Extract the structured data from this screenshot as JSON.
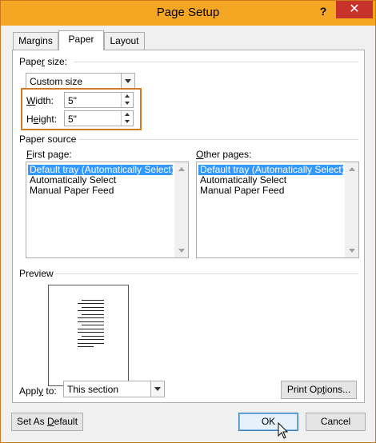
{
  "window": {
    "title": "Page Setup",
    "help_label": "?",
    "close_label": "✕"
  },
  "tabs": [
    {
      "label": "Margins",
      "active": false
    },
    {
      "label": "Paper",
      "active": true
    },
    {
      "label": "Layout",
      "active": false
    }
  ],
  "paper_size": {
    "section_label_pre": "Pape",
    "section_label_acc": "r",
    "section_label_post": " size:",
    "selected": "Custom size",
    "width_label_acc": "W",
    "width_label_post": "idth:",
    "width_value": "5\"",
    "height_label_pre": "H",
    "height_label_acc": "e",
    "height_label_post": "ight:",
    "height_value": "5\""
  },
  "paper_source": {
    "section_label": "Paper source",
    "first_page_label_acc": "F",
    "first_page_label_post": "irst page:",
    "other_pages_label_acc": "O",
    "other_pages_label_post": "ther pages:",
    "first_page_items": [
      "Default tray (Automatically Select)",
      "Automatically Select",
      "Manual Paper Feed"
    ],
    "other_pages_items": [
      "Default tray (Automatically Select)",
      "Automatically Select",
      "Manual Paper Feed"
    ],
    "selected_index": 0
  },
  "preview": {
    "section_label": "Preview"
  },
  "apply_to": {
    "label_pre": "Appl",
    "label_acc": "y",
    "label_post": " to:",
    "selected": "This section"
  },
  "buttons": {
    "print_options_pre": "Print Op",
    "print_options_acc": "t",
    "print_options_post": "ions...",
    "set_default_pre": "Set As ",
    "set_default_acc": "D",
    "set_default_post": "efault",
    "ok": "OK",
    "cancel": "Cancel"
  },
  "colors": {
    "title_bar": "#f5a623",
    "close_button": "#c7332b",
    "highlight_box": "#d07a26",
    "selection": "#3399ff"
  }
}
